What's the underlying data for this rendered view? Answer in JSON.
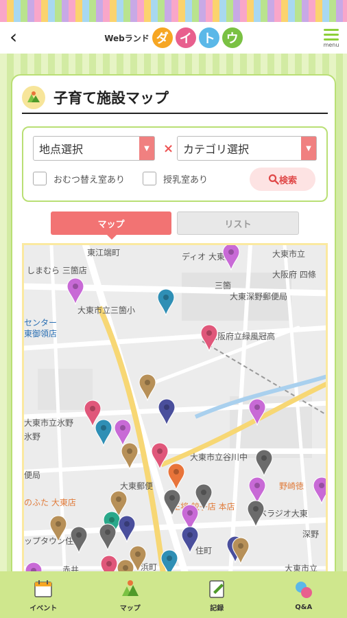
{
  "header": {
    "logo_small": "Webランド",
    "logo_chars": [
      "ダ",
      "イ",
      "ト",
      "ウ"
    ],
    "logo_colors": [
      "#f6a623",
      "#e85f8e",
      "#5bb8e8",
      "#7ac143"
    ],
    "menu_label": "menu"
  },
  "page": {
    "title": "子育て施設マップ"
  },
  "filters": {
    "location_select": "地点選択",
    "category_select": "カテゴリ選択",
    "separator": "×",
    "checkbox_diaper": "おむつ替え室あり",
    "checkbox_nursing": "授乳室あり",
    "search_label": "検索"
  },
  "tabs": {
    "map": "マップ",
    "list": "リスト"
  },
  "map": {
    "labels": [
      "東江端町",
      "しまむら 三箇店",
      "ディオ 大東店",
      "大東市立",
      "大阪府 四條",
      "大東市立三箇小",
      "大東深野郵便局",
      "センター",
      "東御領店",
      "大阪府立緑風冠高",
      "大東市立氷野",
      "氷野",
      "大東市立谷川中",
      "便局",
      "大東郵便",
      "野崎徳",
      "のふた 大東店",
      "王将 餃子店 本店",
      "ベラジオ大東",
      "ップタウン住道",
      "深野",
      "大東市立",
      "赤井",
      "浜町",
      "三箇",
      "住町"
    ],
    "pin_colors": {
      "pink": "#e0577a",
      "purple": "#c86ad6",
      "blue": "#2f8fb5",
      "navy": "#4a4f9c",
      "brown": "#b79058",
      "gray": "#6b6b6b",
      "orange": "#e8743a",
      "teal": "#2aa88a"
    }
  },
  "bottom_nav": [
    {
      "label": "イベント",
      "icon": "calendar-icon"
    },
    {
      "label": "マップ",
      "icon": "map-person-icon"
    },
    {
      "label": "記録",
      "icon": "notebook-icon"
    },
    {
      "label": "Q&A",
      "icon": "chat-bubbles-icon"
    }
  ]
}
